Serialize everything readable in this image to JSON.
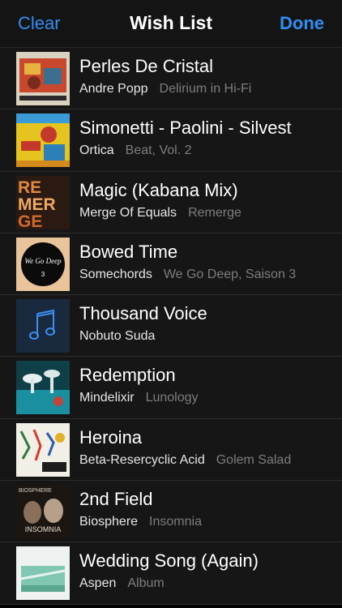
{
  "navbar": {
    "left_label": "Clear",
    "title": "Wish List",
    "right_label": "Done",
    "accent": "#2e8ff5"
  },
  "items": [
    {
      "title": "Perles De Cristal",
      "artist": "Andre Popp",
      "album": "Delirium in Hi-Fi",
      "art_icon": "album-art"
    },
    {
      "title": "Simonetti - Paolini - Silvest",
      "artist": "Ortica",
      "album": "Beat, Vol. 2",
      "art_icon": "album-art"
    },
    {
      "title": "Magic (Kabana Mix)",
      "artist": "Merge Of Equals",
      "album": "Remerge",
      "art_icon": "album-art"
    },
    {
      "title": "Bowed Time",
      "artist": "Somechords",
      "album": "We Go Deep, Saison 3",
      "art_icon": "album-art"
    },
    {
      "title": "Thousand Voice",
      "artist": "Nobuto Suda",
      "album": "",
      "art_icon": "music-note-icon"
    },
    {
      "title": "Redemption",
      "artist": "Mindelixir",
      "album": "Lunology",
      "art_icon": "album-art"
    },
    {
      "title": "Heroina",
      "artist": "Beta-Resercyclic Acid",
      "album": "Golem Salad",
      "art_icon": "album-art"
    },
    {
      "title": "2nd Field",
      "artist": "Biosphere",
      "album": "Insomnia",
      "art_icon": "album-art"
    },
    {
      "title": "Wedding Song (Again)",
      "artist": "Aspen",
      "album": "Album",
      "art_icon": "album-art"
    }
  ],
  "art_text": {
    "remerge": [
      "RE",
      "MER",
      "GE"
    ],
    "wegodeep": "We Go Deep",
    "wegodeep_num": "3",
    "biosphere_top": "BIOSPHERE",
    "biosphere_bottom": "INSOMNIA"
  }
}
